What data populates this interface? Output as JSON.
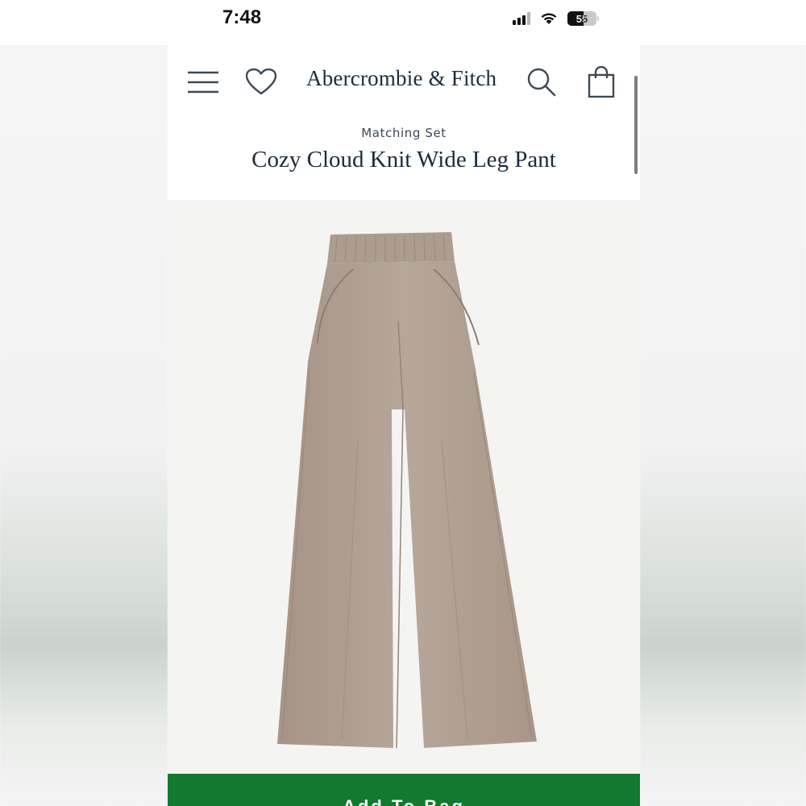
{
  "status_bar": {
    "time": "7:48",
    "battery_level": "55",
    "icons": [
      "cellular-signal-icon",
      "wifi-icon",
      "battery-icon"
    ]
  },
  "header": {
    "brand": "Abercrombie & Fitch",
    "icons": [
      "hamburger-menu-icon",
      "heart-icon",
      "search-icon",
      "shopping-bag-icon"
    ]
  },
  "product": {
    "category": "Matching Set",
    "title": "Cozy Cloud Knit Wide Leg Pant",
    "image_subject": "taupe wide leg knit pant",
    "color": "#b1a194"
  },
  "cta": {
    "label": "Add To Bag",
    "color": "#12792f"
  }
}
